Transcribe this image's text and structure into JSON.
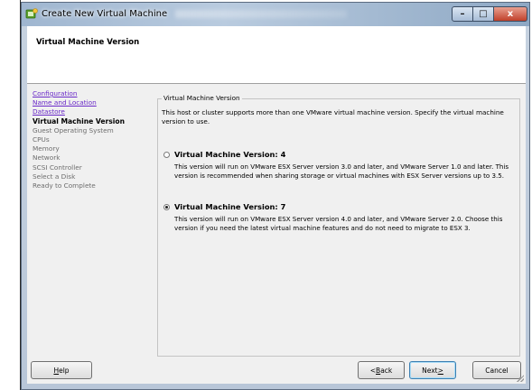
{
  "window": {
    "title": "Create New Virtual Machine",
    "minimize_glyph": "–",
    "maximize_glyph": "□",
    "close_glyph": "x"
  },
  "header": {
    "title": "Virtual Machine Version"
  },
  "steps": [
    {
      "label": "Configuration",
      "state": "link"
    },
    {
      "label": "Name and Location",
      "state": "link"
    },
    {
      "label": "Datastore",
      "state": "link"
    },
    {
      "label": "Virtual Machine Version",
      "state": "current"
    },
    {
      "label": "Guest Operating System",
      "state": "pending"
    },
    {
      "label": "CPUs",
      "state": "pending"
    },
    {
      "label": "Memory",
      "state": "pending"
    },
    {
      "label": "Network",
      "state": "pending"
    },
    {
      "label": "SCSI Controller",
      "state": "pending"
    },
    {
      "label": "Select a Disk",
      "state": "pending"
    },
    {
      "label": "Ready to Complete",
      "state": "pending"
    }
  ],
  "main": {
    "group_title": "Virtual Machine Version",
    "intro": "This host or cluster supports more than one VMware virtual machine version. Specify the virtual machine version to use.",
    "options": [
      {
        "label": "Virtual Machine Version: 4",
        "description": "This version will run on VMware ESX Server version 3.0 and later, and VMware Server 1.0 and later. This version is recommended when sharing storage or virtual machines with ESX Server versions up to 3.5.",
        "selected": false
      },
      {
        "label": "Virtual Machine Version: 7",
        "description": "This version will run on VMware ESX Server version 4.0 and later, and VMware Server 2.0. Choose this version if you need the latest virtual machine features and do not need to migrate to ESX 3.",
        "selected": true
      }
    ]
  },
  "buttons": {
    "help": {
      "pre": "",
      "key": "H",
      "post": "elp"
    },
    "back": {
      "pre": "< ",
      "key": "B",
      "post": "ack"
    },
    "next": {
      "pre": "Next ",
      "key": ">",
      "post": ""
    },
    "cancel": "Cancel"
  },
  "colors": {
    "link": "#6a2ac8",
    "disabled_text": "#6d6d6d",
    "window_frame": "#b8c6d8",
    "close_button": "#c0402a"
  },
  "icons": {
    "app": "vmware-new-vm-icon",
    "radio_selected": "radio-selected",
    "radio_unselected": "radio-unselected"
  }
}
